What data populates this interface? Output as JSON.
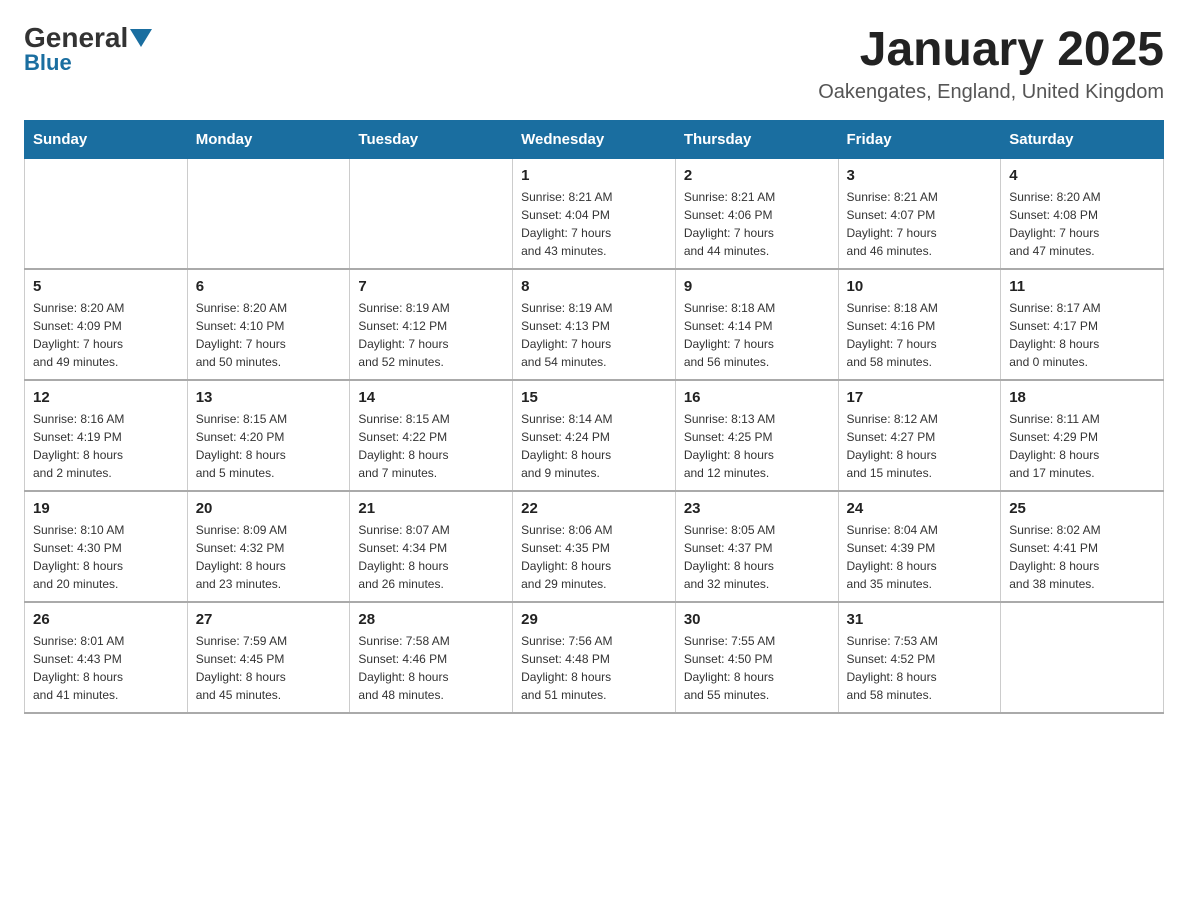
{
  "logo": {
    "general": "General",
    "blue": "Blue"
  },
  "title": "January 2025",
  "subtitle": "Oakengates, England, United Kingdom",
  "days_of_week": [
    "Sunday",
    "Monday",
    "Tuesday",
    "Wednesday",
    "Thursday",
    "Friday",
    "Saturday"
  ],
  "weeks": [
    [
      {
        "day": "",
        "info": ""
      },
      {
        "day": "",
        "info": ""
      },
      {
        "day": "",
        "info": ""
      },
      {
        "day": "1",
        "info": "Sunrise: 8:21 AM\nSunset: 4:04 PM\nDaylight: 7 hours\nand 43 minutes."
      },
      {
        "day": "2",
        "info": "Sunrise: 8:21 AM\nSunset: 4:06 PM\nDaylight: 7 hours\nand 44 minutes."
      },
      {
        "day": "3",
        "info": "Sunrise: 8:21 AM\nSunset: 4:07 PM\nDaylight: 7 hours\nand 46 minutes."
      },
      {
        "day": "4",
        "info": "Sunrise: 8:20 AM\nSunset: 4:08 PM\nDaylight: 7 hours\nand 47 minutes."
      }
    ],
    [
      {
        "day": "5",
        "info": "Sunrise: 8:20 AM\nSunset: 4:09 PM\nDaylight: 7 hours\nand 49 minutes."
      },
      {
        "day": "6",
        "info": "Sunrise: 8:20 AM\nSunset: 4:10 PM\nDaylight: 7 hours\nand 50 minutes."
      },
      {
        "day": "7",
        "info": "Sunrise: 8:19 AM\nSunset: 4:12 PM\nDaylight: 7 hours\nand 52 minutes."
      },
      {
        "day": "8",
        "info": "Sunrise: 8:19 AM\nSunset: 4:13 PM\nDaylight: 7 hours\nand 54 minutes."
      },
      {
        "day": "9",
        "info": "Sunrise: 8:18 AM\nSunset: 4:14 PM\nDaylight: 7 hours\nand 56 minutes."
      },
      {
        "day": "10",
        "info": "Sunrise: 8:18 AM\nSunset: 4:16 PM\nDaylight: 7 hours\nand 58 minutes."
      },
      {
        "day": "11",
        "info": "Sunrise: 8:17 AM\nSunset: 4:17 PM\nDaylight: 8 hours\nand 0 minutes."
      }
    ],
    [
      {
        "day": "12",
        "info": "Sunrise: 8:16 AM\nSunset: 4:19 PM\nDaylight: 8 hours\nand 2 minutes."
      },
      {
        "day": "13",
        "info": "Sunrise: 8:15 AM\nSunset: 4:20 PM\nDaylight: 8 hours\nand 5 minutes."
      },
      {
        "day": "14",
        "info": "Sunrise: 8:15 AM\nSunset: 4:22 PM\nDaylight: 8 hours\nand 7 minutes."
      },
      {
        "day": "15",
        "info": "Sunrise: 8:14 AM\nSunset: 4:24 PM\nDaylight: 8 hours\nand 9 minutes."
      },
      {
        "day": "16",
        "info": "Sunrise: 8:13 AM\nSunset: 4:25 PM\nDaylight: 8 hours\nand 12 minutes."
      },
      {
        "day": "17",
        "info": "Sunrise: 8:12 AM\nSunset: 4:27 PM\nDaylight: 8 hours\nand 15 minutes."
      },
      {
        "day": "18",
        "info": "Sunrise: 8:11 AM\nSunset: 4:29 PM\nDaylight: 8 hours\nand 17 minutes."
      }
    ],
    [
      {
        "day": "19",
        "info": "Sunrise: 8:10 AM\nSunset: 4:30 PM\nDaylight: 8 hours\nand 20 minutes."
      },
      {
        "day": "20",
        "info": "Sunrise: 8:09 AM\nSunset: 4:32 PM\nDaylight: 8 hours\nand 23 minutes."
      },
      {
        "day": "21",
        "info": "Sunrise: 8:07 AM\nSunset: 4:34 PM\nDaylight: 8 hours\nand 26 minutes."
      },
      {
        "day": "22",
        "info": "Sunrise: 8:06 AM\nSunset: 4:35 PM\nDaylight: 8 hours\nand 29 minutes."
      },
      {
        "day": "23",
        "info": "Sunrise: 8:05 AM\nSunset: 4:37 PM\nDaylight: 8 hours\nand 32 minutes."
      },
      {
        "day": "24",
        "info": "Sunrise: 8:04 AM\nSunset: 4:39 PM\nDaylight: 8 hours\nand 35 minutes."
      },
      {
        "day": "25",
        "info": "Sunrise: 8:02 AM\nSunset: 4:41 PM\nDaylight: 8 hours\nand 38 minutes."
      }
    ],
    [
      {
        "day": "26",
        "info": "Sunrise: 8:01 AM\nSunset: 4:43 PM\nDaylight: 8 hours\nand 41 minutes."
      },
      {
        "day": "27",
        "info": "Sunrise: 7:59 AM\nSunset: 4:45 PM\nDaylight: 8 hours\nand 45 minutes."
      },
      {
        "day": "28",
        "info": "Sunrise: 7:58 AM\nSunset: 4:46 PM\nDaylight: 8 hours\nand 48 minutes."
      },
      {
        "day": "29",
        "info": "Sunrise: 7:56 AM\nSunset: 4:48 PM\nDaylight: 8 hours\nand 51 minutes."
      },
      {
        "day": "30",
        "info": "Sunrise: 7:55 AM\nSunset: 4:50 PM\nDaylight: 8 hours\nand 55 minutes."
      },
      {
        "day": "31",
        "info": "Sunrise: 7:53 AM\nSunset: 4:52 PM\nDaylight: 8 hours\nand 58 minutes."
      },
      {
        "day": "",
        "info": ""
      }
    ]
  ]
}
